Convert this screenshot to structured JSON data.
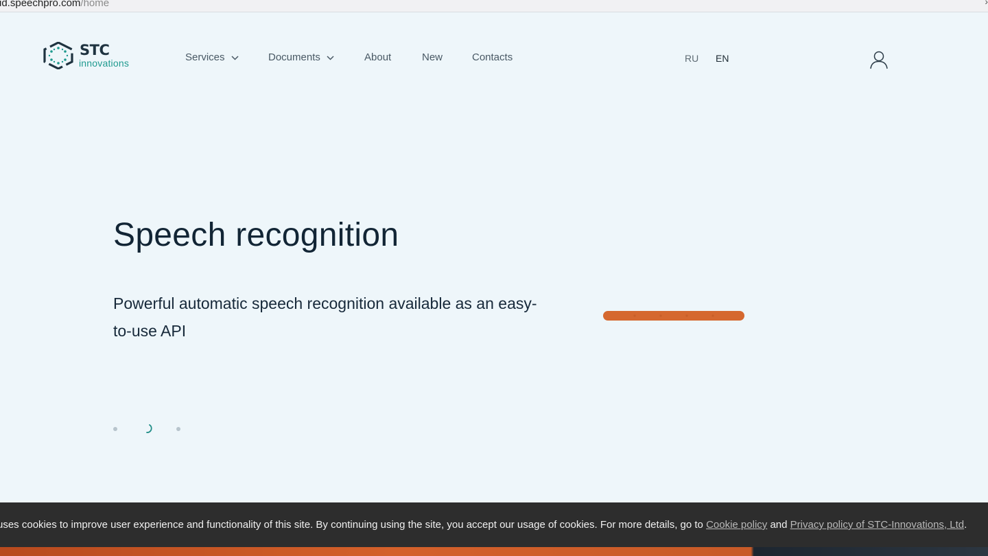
{
  "browser": {
    "url_host": "ud.speechpro.com",
    "url_path": "/home"
  },
  "logo": {
    "brand": "STC",
    "sub": "innovations"
  },
  "nav": {
    "services": "Services",
    "documents": "Documents",
    "about": "About",
    "new": "New",
    "contacts": "Contacts"
  },
  "lang": {
    "ru": "RU",
    "en": "EN",
    "active": "EN"
  },
  "hero": {
    "title": "Speech recognition",
    "subtitle": "Powerful automatic speech recognition available as an easy-to-use API"
  },
  "slider": {
    "count": 3,
    "active_index": 1
  },
  "cookie": {
    "text_before": "uses cookies to improve user experience and functionality of this site. By continuing using the site, you accept our usage of cookies. For more details, go to ",
    "cookie_link": "Cookie policy",
    "and": " and ",
    "privacy_link": "Privacy policy of STC-Innovations, Ltd",
    "end": "."
  },
  "colors": {
    "background": "#eef6fa",
    "accent_teal": "#1f9a8f",
    "wave_orange": "#d5682f",
    "cookie_bar": "#2d2d2d"
  }
}
